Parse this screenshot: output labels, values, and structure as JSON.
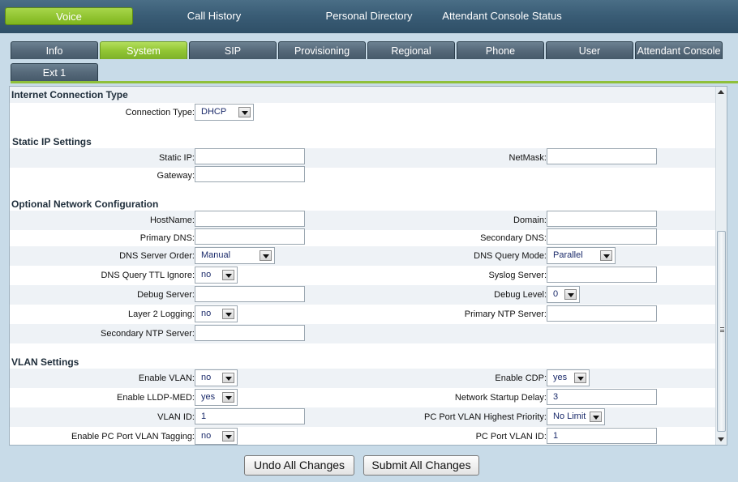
{
  "topnav": {
    "items": [
      "Voice",
      "Call History",
      "Personal Directory",
      "Attendant Console Status"
    ]
  },
  "tabs": {
    "row1": [
      "Info",
      "System",
      "SIP",
      "Provisioning",
      "Regional",
      "Phone",
      "User",
      "Attendant Console"
    ],
    "row2": [
      "Ext 1"
    ],
    "active": "System"
  },
  "sections": {
    "internet": "Internet Connection Type",
    "static": "Static IP Settings",
    "optional": "Optional Network Configuration",
    "vlan": "VLAN Settings"
  },
  "fields": {
    "connection_type": {
      "label": "Connection Type:",
      "value": "DHCP"
    },
    "static_ip": {
      "label": "Static IP:",
      "value": ""
    },
    "netmask": {
      "label": "NetMask:",
      "value": ""
    },
    "gateway": {
      "label": "Gateway:",
      "value": ""
    },
    "hostname": {
      "label": "HostName:",
      "value": ""
    },
    "domain": {
      "label": "Domain:",
      "value": ""
    },
    "primary_dns": {
      "label": "Primary DNS:",
      "value": ""
    },
    "secondary_dns": {
      "label": "Secondary DNS:",
      "value": ""
    },
    "dns_server_order": {
      "label": "DNS Server Order:",
      "value": "Manual"
    },
    "dns_query_mode": {
      "label": "DNS Query Mode:",
      "value": "Parallel"
    },
    "dns_query_ttl_ignore": {
      "label": "DNS Query TTL Ignore:",
      "value": "no"
    },
    "syslog_server": {
      "label": "Syslog Server:",
      "value": ""
    },
    "debug_server": {
      "label": "Debug Server:",
      "value": ""
    },
    "debug_level": {
      "label": "Debug Level:",
      "value": "0"
    },
    "layer2_logging": {
      "label": "Layer 2 Logging:",
      "value": "no"
    },
    "primary_ntp": {
      "label": "Primary NTP Server:",
      "value": ""
    },
    "secondary_ntp": {
      "label": "Secondary NTP Server:",
      "value": ""
    },
    "enable_vlan": {
      "label": "Enable VLAN:",
      "value": "no"
    },
    "enable_cdp": {
      "label": "Enable CDP:",
      "value": "yes"
    },
    "enable_lldp_med": {
      "label": "Enable LLDP-MED:",
      "value": "yes"
    },
    "network_startup_delay": {
      "label": "Network Startup Delay:",
      "value": "3"
    },
    "vlan_id": {
      "label": "VLAN ID:",
      "value": "1"
    },
    "pc_port_vlan_priority": {
      "label": "PC Port VLAN Highest Priority:",
      "value": "No Limit"
    },
    "enable_pc_port_vlan_tagging": {
      "label": "Enable PC Port VLAN Tagging:",
      "value": "no"
    },
    "pc_port_vlan_id": {
      "label": "PC Port VLAN ID:",
      "value": "1"
    }
  },
  "buttons": {
    "undo": "Undo All Changes",
    "submit": "Submit All Changes"
  }
}
